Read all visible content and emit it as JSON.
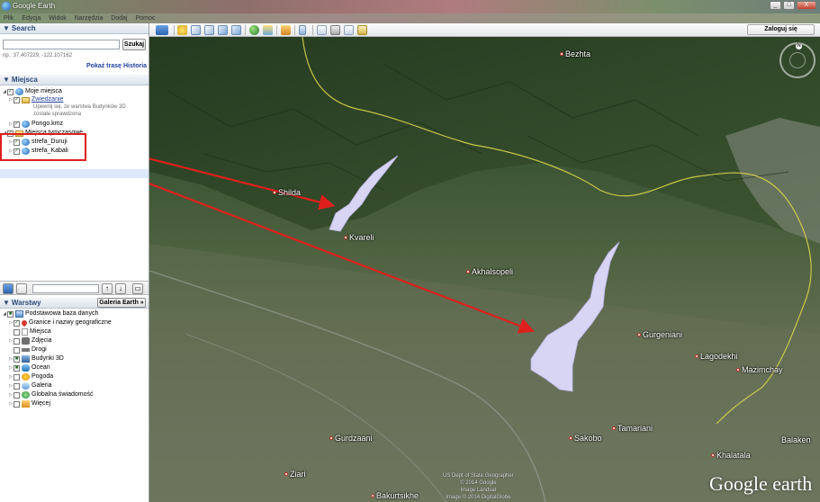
{
  "window": {
    "title": "Google Earth",
    "controls": [
      "_",
      "□",
      "X"
    ]
  },
  "menu": [
    "Plik",
    "Edycja",
    "Widok",
    "Narzędzia",
    "Dodaj",
    "Pomoc"
  ],
  "toolbar": {
    "login_label": "Zaloguj się"
  },
  "search": {
    "header": "Search",
    "button_label": "Szukaj",
    "input_value": "",
    "hint": "np.: 37.407229, -122.107162",
    "route_link": "Pokaż trasę",
    "history_link": "Historia"
  },
  "places": {
    "header": "Miejsca",
    "items": [
      {
        "label": "Moje miejsca",
        "level": 0,
        "icon": "globe-icon",
        "checked": true
      },
      {
        "label": "Zwiedzanie",
        "level": 1,
        "icon": "folder-icon",
        "checked": true,
        "link": true
      },
      {
        "label": "Upewnij się, że warstwa Budynków 3D",
        "level": 2,
        "note": true
      },
      {
        "label": "została sprawdzona",
        "level": 2,
        "note": true
      },
      {
        "label": "Pongo.kmz",
        "level": 1,
        "icon": "globe-icon",
        "checked": true
      },
      {
        "label": "Miejsca tymczasowe",
        "level": 0,
        "icon": "folder-icon",
        "checked": true
      },
      {
        "label": "strefa_Duruji",
        "level": 1,
        "icon": "globe-icon",
        "checked": true
      },
      {
        "label": "strefa_Kabali",
        "level": 1,
        "icon": "globe-icon",
        "checked": true,
        "selected": true
      }
    ]
  },
  "layers": {
    "header": "Warstwy",
    "gallery_button": "Galeria Earth »",
    "items": [
      {
        "label": "Podstawowa baza danych",
        "level": 0,
        "icon": "layer-icon",
        "checked": true
      },
      {
        "label": "Granice i nazwy geograficzne",
        "level": 1,
        "icon": "pin-icon",
        "checked": true
      },
      {
        "label": "Miejsca",
        "level": 1,
        "icon": "doc-icon",
        "checked": false
      },
      {
        "label": "Zdjęcia",
        "level": 1,
        "icon": "camera-icon",
        "checked": false
      },
      {
        "label": "Drogi",
        "level": 1,
        "icon": "road-icon",
        "checked": false
      },
      {
        "label": "Budynki 3D",
        "level": 1,
        "icon": "building-icon",
        "checked": true
      },
      {
        "label": "Ocean",
        "level": 1,
        "icon": "ocean-icon",
        "checked": true
      },
      {
        "label": "Pogoda",
        "level": 1,
        "icon": "sun-icon",
        "checked": false
      },
      {
        "label": "Galeria",
        "level": 1,
        "icon": "gallery-icon",
        "checked": false
      },
      {
        "label": "Globalna świadomość",
        "level": 1,
        "icon": "awareness-icon",
        "checked": false
      },
      {
        "label": "Więcej",
        "level": 1,
        "icon": "more-icon",
        "checked": false
      }
    ]
  },
  "map": {
    "places": [
      {
        "name": "Bezhta"
      },
      {
        "name": "Shilda"
      },
      {
        "name": "Kvareli"
      },
      {
        "name": "Akhalsopeli"
      },
      {
        "name": "Gurgeniani"
      },
      {
        "name": "Lagodekhi"
      },
      {
        "name": "Mazimchay"
      },
      {
        "name": "Tamariani"
      },
      {
        "name": "Sakobo"
      },
      {
        "name": "Khalatala"
      },
      {
        "name": "Balaken"
      },
      {
        "name": "Gurdzaani"
      },
      {
        "name": "Ziari"
      },
      {
        "name": "Bakurtsikhe"
      }
    ],
    "attribution": [
      "US Dept of State Geographer",
      "© 2014 Google",
      "Image Landsat",
      "Image © 2014 DigitalGlobe"
    ],
    "logo": "Google earth",
    "compass_label": "N",
    "colors": {
      "zone_fill": "#d8d4f4",
      "arrow": "#e0201c",
      "border_line": "#d7d34a"
    }
  }
}
